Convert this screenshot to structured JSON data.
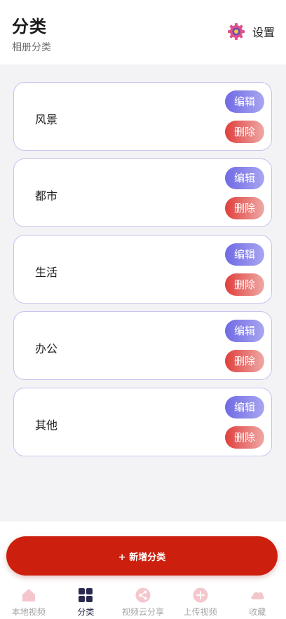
{
  "header": {
    "title": "分类",
    "subtitle": "相册分类",
    "settings_label": "设置",
    "settings_icon": "gear-icon"
  },
  "categories": [
    {
      "name": "风景",
      "edit_label": "编辑",
      "delete_label": "删除"
    },
    {
      "name": "都市",
      "edit_label": "编辑",
      "delete_label": "删除"
    },
    {
      "name": "生活",
      "edit_label": "编辑",
      "delete_label": "删除"
    },
    {
      "name": "办公",
      "edit_label": "编辑",
      "delete_label": "删除"
    },
    {
      "name": "其他",
      "edit_label": "编辑",
      "delete_label": "删除"
    }
  ],
  "add_button": {
    "label": "+ 新增分类"
  },
  "tabbar": {
    "active": "tab-category",
    "tabs": [
      {
        "label": "本地视频",
        "icon": "home-icon"
      },
      {
        "label": "分类",
        "icon": "grid-icon"
      },
      {
        "label": "视频云分享",
        "icon": "share-icon"
      },
      {
        "label": "上传视频",
        "icon": "plus-circle-icon"
      },
      {
        "label": "收藏",
        "icon": "cloud-icon"
      }
    ]
  },
  "colors": {
    "accent_red": "#cc1f0e",
    "edit_gradient": [
      "#6f6ae3",
      "#a9a6f1"
    ],
    "delete_gradient": [
      "#df3f3c",
      "#eea9a6"
    ],
    "card_border": "#c6c4ec",
    "tab_inactive_icon": "#f3c7cc",
    "tab_active_icon": "#2a2a4e"
  }
}
